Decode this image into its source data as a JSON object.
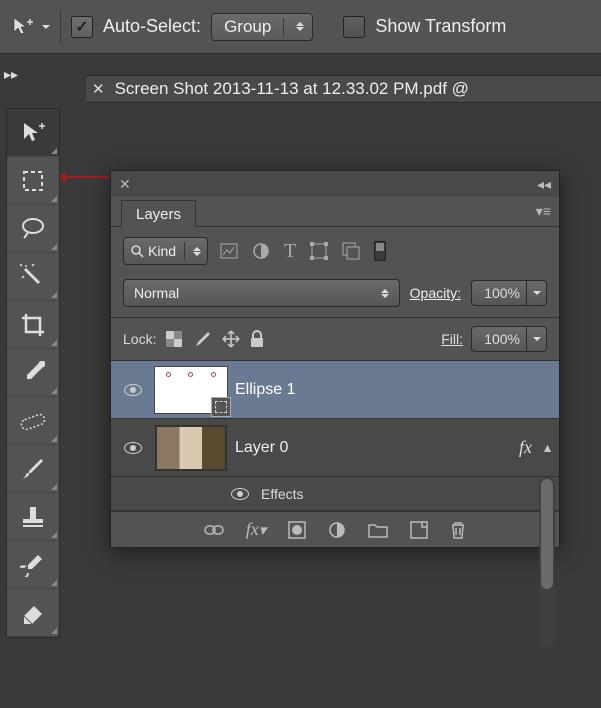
{
  "options_bar": {
    "auto_select_label": "Auto-Select:",
    "auto_select_value": "Group",
    "show_transform_label": "Show Transform"
  },
  "document": {
    "title": "Screen Shot 2013-11-13 at 12.33.02 PM.pdf @"
  },
  "layers_panel": {
    "title": "Layers",
    "filter_kind": "Kind",
    "blend_mode": "Normal",
    "opacity_label": "Opacity:",
    "opacity_value": "100%",
    "lock_label": "Lock:",
    "fill_label": "Fill:",
    "fill_value": "100%",
    "effects_label": "Effects",
    "layers": [
      {
        "name": "Ellipse 1",
        "selected": true,
        "has_fx": false,
        "is_vector": true
      },
      {
        "name": "Layer 0",
        "selected": false,
        "has_fx": true,
        "is_vector": false
      }
    ]
  }
}
